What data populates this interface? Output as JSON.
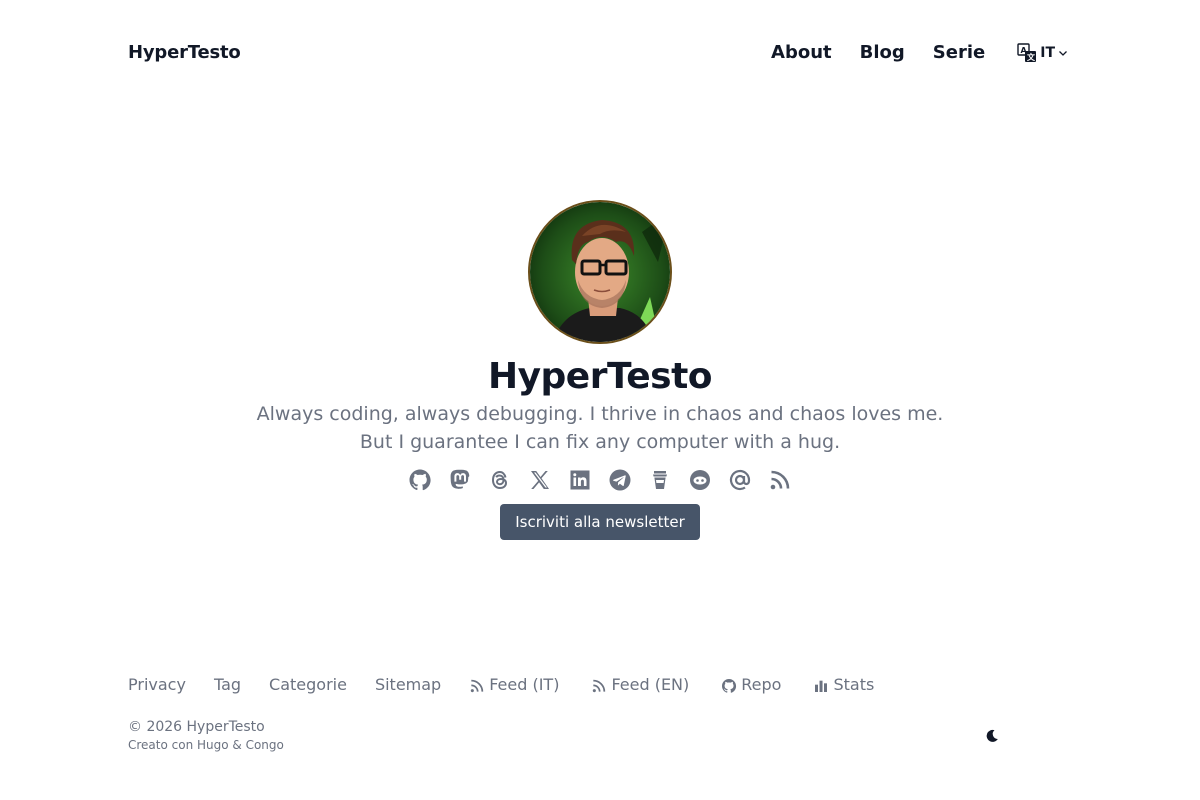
{
  "header": {
    "site_title": "HyperTesto",
    "nav": [
      {
        "label": "About"
      },
      {
        "label": "Blog"
      },
      {
        "label": "Serie"
      }
    ],
    "language": {
      "code": "IT",
      "icon": "translate-icon"
    }
  },
  "hero": {
    "name": "HyperTesto",
    "bio_line1": "Always coding, always debugging. I thrive in chaos and chaos loves me.",
    "bio_line2": "But I guarantee I can fix any computer with a hug.",
    "socials": [
      {
        "icon": "github-icon"
      },
      {
        "icon": "mastodon-icon"
      },
      {
        "icon": "threads-icon"
      },
      {
        "icon": "x-icon"
      },
      {
        "icon": "linkedin-icon"
      },
      {
        "icon": "telegram-icon"
      },
      {
        "icon": "buymeacoffee-icon"
      },
      {
        "icon": "matrix-icon"
      },
      {
        "icon": "email-at-icon"
      },
      {
        "icon": "rss-icon"
      }
    ],
    "newsletter_label": "Iscriviti alla newsletter"
  },
  "footer": {
    "links": [
      {
        "label": "Privacy"
      },
      {
        "label": "Tag"
      },
      {
        "label": "Categorie"
      },
      {
        "label": "Sitemap"
      },
      {
        "label": "Feed (IT)",
        "icon": "rss-icon"
      },
      {
        "label": "Feed (EN)",
        "icon": "rss-icon"
      },
      {
        "label": "Repo",
        "icon": "github-icon"
      },
      {
        "label": "Stats",
        "icon": "bar-chart-icon"
      }
    ],
    "copyright": "© 2026 HyperTesto",
    "built_with": "Creato con Hugo & Congo"
  },
  "colors": {
    "text": "#111827",
    "muted": "#6b7280",
    "button": "#475569",
    "icon": "#6b7280"
  }
}
